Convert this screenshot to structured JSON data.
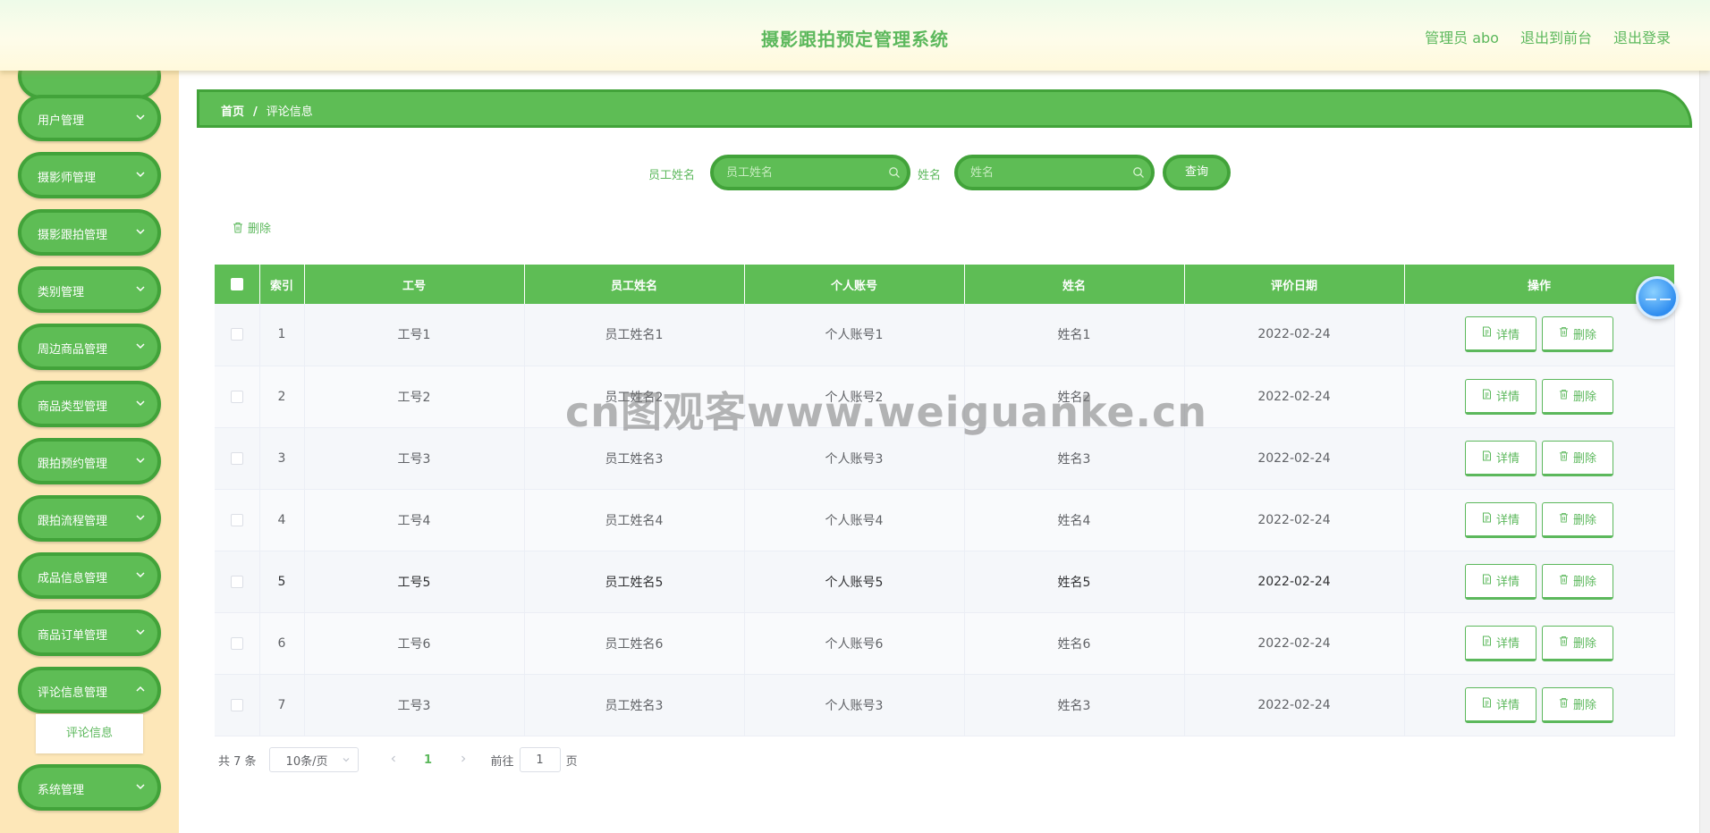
{
  "app": {
    "title": "摄影跟拍预定管理系统"
  },
  "header": {
    "user": "管理员 abo",
    "to_front": "退出到前台",
    "logout": "退出登录"
  },
  "sidebar": {
    "items": [
      {
        "label": "用户管理"
      },
      {
        "label": "摄影师管理"
      },
      {
        "label": "摄影跟拍管理"
      },
      {
        "label": "类别管理"
      },
      {
        "label": "周边商品管理"
      },
      {
        "label": "商品类型管理"
      },
      {
        "label": "跟拍预约管理"
      },
      {
        "label": "跟拍流程管理"
      },
      {
        "label": "成品信息管理"
      },
      {
        "label": "商品订单管理"
      },
      {
        "label": "评论信息管理"
      },
      {
        "label": "系统管理"
      }
    ],
    "active_sub": "评论信息"
  },
  "breadcrumb": {
    "home": "首页",
    "sep": "/",
    "current": "评论信息"
  },
  "search": {
    "employee_label": "员工姓名",
    "employee_placeholder": "员工姓名",
    "name_label": "姓名",
    "name_placeholder": "姓名",
    "query": "查询"
  },
  "toolbar": {
    "delete": "删除"
  },
  "table": {
    "headers": [
      "索引",
      "工号",
      "员工姓名",
      "个人账号",
      "姓名",
      "评价日期",
      "操作"
    ],
    "rows": [
      {
        "index": "1",
        "job_no": "工号1",
        "employee": "员工姓名1",
        "account": "个人账号1",
        "name": "姓名1",
        "date": "2022-02-24"
      },
      {
        "index": "2",
        "job_no": "工号2",
        "employee": "员工姓名2",
        "account": "个人账号2",
        "name": "姓名2",
        "date": "2022-02-24"
      },
      {
        "index": "3",
        "job_no": "工号3",
        "employee": "员工姓名3",
        "account": "个人账号3",
        "name": "姓名3",
        "date": "2022-02-24"
      },
      {
        "index": "4",
        "job_no": "工号4",
        "employee": "员工姓名4",
        "account": "个人账号4",
        "name": "姓名4",
        "date": "2022-02-24"
      },
      {
        "index": "5",
        "job_no": "工号5",
        "employee": "员工姓名5",
        "account": "个人账号5",
        "name": "姓名5",
        "date": "2022-02-24"
      },
      {
        "index": "6",
        "job_no": "工号6",
        "employee": "员工姓名6",
        "account": "个人账号6",
        "name": "姓名6",
        "date": "2022-02-24"
      },
      {
        "index": "7",
        "job_no": "工号3",
        "employee": "员工姓名3",
        "account": "个人账号3",
        "name": "姓名3",
        "date": "2022-02-24"
      }
    ],
    "detail_label": "详情",
    "delete_label": "删除"
  },
  "pagination": {
    "total": "共 7 条",
    "page_size": "10条/页",
    "current_page": "1",
    "goto_prefix": "前往",
    "goto_value": "1",
    "goto_suffix": "页"
  },
  "watermark": "cn图观客www.weiguanke.cn",
  "colors": {
    "primary": "#5ebd55",
    "primary_dark": "#42a33a",
    "sidebar_bg": "#fde7b8",
    "text_green": "#5cb85c"
  }
}
